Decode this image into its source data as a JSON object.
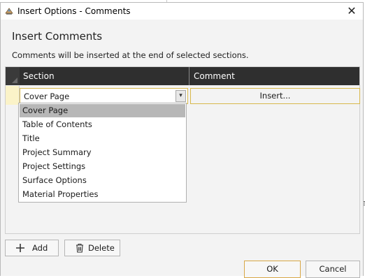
{
  "window": {
    "title": "Insert Options - Comments",
    "close_glyph": "✕"
  },
  "heading": "Insert Comments",
  "subtitle": "Comments will be inserted at the end of selected sections.",
  "grid": {
    "columns": [
      "Section",
      "Comment"
    ],
    "row": {
      "section_value": "Cover Page",
      "comment_button": "Insert..."
    }
  },
  "dropdown": {
    "selected_index": 0,
    "options": [
      "Cover Page",
      "Table of Contents",
      "Title",
      "Project Summary",
      "Project Settings",
      "Surface Options",
      "Material Properties"
    ]
  },
  "toolbar": {
    "add_label": "Add",
    "delete_label": "Delete"
  },
  "dialog_buttons": {
    "ok_label": "OK",
    "cancel_label": "Cancel"
  },
  "background": {
    "partial_char": "e"
  },
  "colors": {
    "header_bg": "#2f2f2f",
    "focus_border": "#d8b84a",
    "selected_option": "#b7b7b7",
    "ok_border": "#d8a847"
  }
}
